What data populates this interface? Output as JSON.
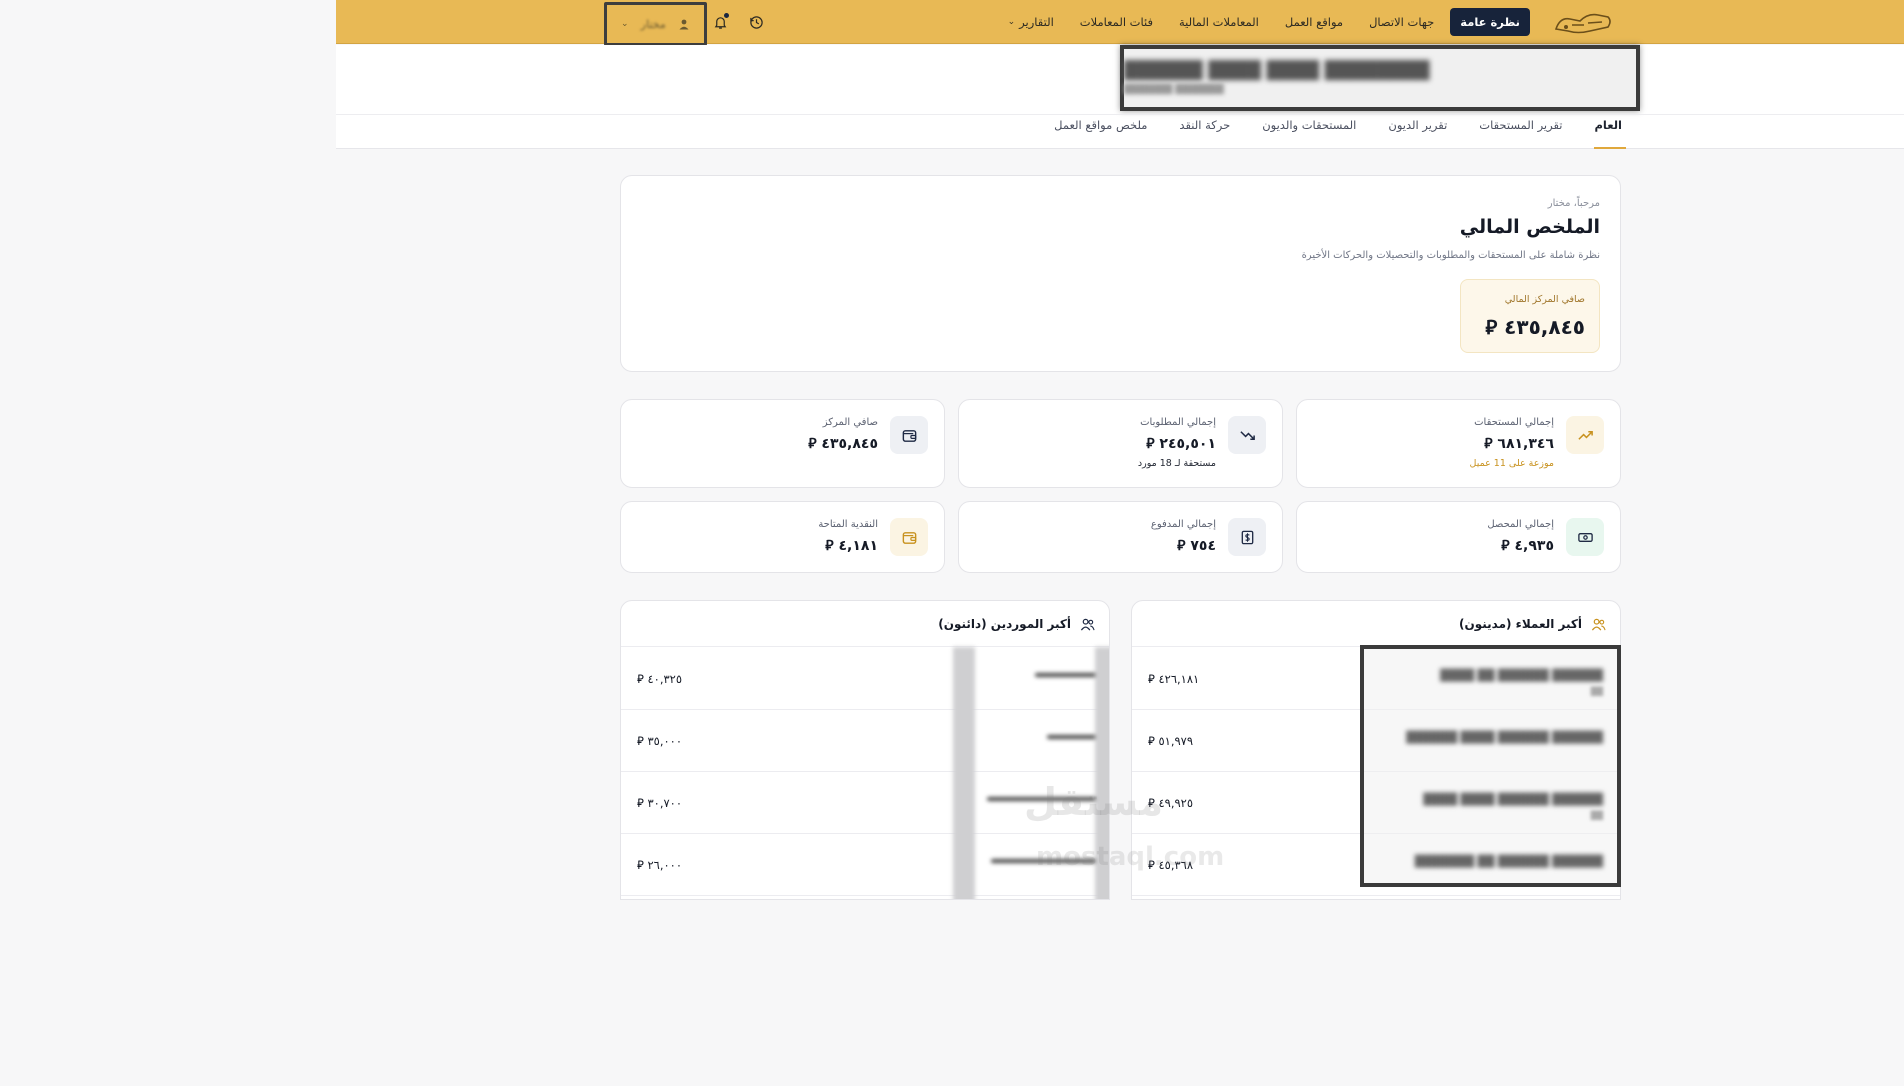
{
  "nav": {
    "items": [
      {
        "label": "نظرة عامة",
        "active": true
      },
      {
        "label": "جهات الاتصال",
        "active": false
      },
      {
        "label": "مواقع العمل",
        "active": false
      },
      {
        "label": "المعاملات المالية",
        "active": false
      },
      {
        "label": "فئات المعاملات",
        "active": false
      },
      {
        "label": "التقارير",
        "active": false,
        "dropdown": true
      }
    ],
    "user_name": "مختار"
  },
  "tabs": [
    {
      "label": "العام",
      "active": true
    },
    {
      "label": "تقرير المستحقات",
      "active": false
    },
    {
      "label": "تقرير الديون",
      "active": false
    },
    {
      "label": "المستحقات والديون",
      "active": false
    },
    {
      "label": "حركة النقد",
      "active": false
    },
    {
      "label": "ملخص مواقع العمل",
      "active": false
    }
  ],
  "summary": {
    "greeting": "مرحباً، مختار",
    "title": "الملخص المالي",
    "description": "نظرة شاملة على المستحقات والمطلوبات والتحصيلات والحركات الأخيرة",
    "net_label": "صافي المركز المالي",
    "net_value": "٤٣٥,٨٤٥ ⃁"
  },
  "stats": {
    "receivables": {
      "label": "إجمالي المستحقات",
      "value": "٦٨١,٣٤٦ ⃁",
      "note": "موزعة على 11 عميل",
      "icon": "trending-up-icon"
    },
    "payables": {
      "label": "إجمالي المطلوبات",
      "value": "٢٤٥,٥٠١ ⃁",
      "note": "مستحقة لـ 18 مورد",
      "icon": "trending-down-icon"
    },
    "net_position": {
      "label": "صافي المركز",
      "value": "٤٣٥,٨٤٥ ⃁",
      "icon": "wallet-icon"
    },
    "collected": {
      "label": "إجمالي المحصل",
      "value": "٤,٩٣٥ ⃁",
      "icon": "banknote-icon"
    },
    "paid": {
      "label": "إجمالي المدفوع",
      "value": "٧٥٤ ⃁",
      "icon": "dollar-receipt-icon"
    },
    "cash_available": {
      "label": "النقدية المتاحة",
      "value": "٤,١٨١ ⃁",
      "icon": "wallet-icon"
    }
  },
  "customers": {
    "title": "أكبر العملاء (مدينون)",
    "rows": [
      {
        "amount": "٤٢٦,١٨١ ⃁"
      },
      {
        "amount": "٥١,٩٧٩ ⃁"
      },
      {
        "amount": "٤٩,٩٢٥ ⃁"
      },
      {
        "amount": "٤٥,٣٦٨ ⃁"
      }
    ]
  },
  "suppliers": {
    "title": "أكبر الموردين (دائنون)",
    "rows": [
      {
        "amount": "٤٠,٣٢٥ ⃁"
      },
      {
        "amount": "٣٥,٠٠٠ ⃁"
      },
      {
        "amount": "٣٠,٧٠٠ ⃁"
      },
      {
        "amount": "٢٦,٠٠٠ ⃁"
      }
    ]
  },
  "colors": {
    "topbar": "#e8b955",
    "nav_active": "#17233a",
    "accent": "#e0a83c",
    "receivable_note": "#c8921f",
    "card_border": "#e4e4e8"
  }
}
